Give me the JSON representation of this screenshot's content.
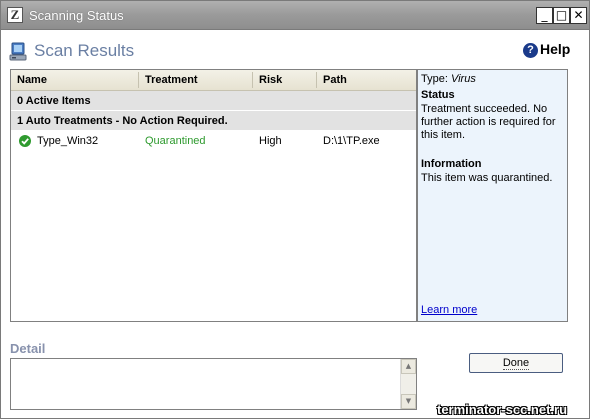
{
  "window": {
    "title": "Scanning Status",
    "logo_glyph": "Z",
    "minimize_glyph": "_",
    "maximize_glyph": "□",
    "close_glyph": "✕"
  },
  "header": {
    "title": "Scan Results",
    "help_label": "Help",
    "help_glyph": "?"
  },
  "results": {
    "columns": [
      "Name",
      "Treatment",
      "Risk",
      "Path"
    ],
    "groups": [
      {
        "label": "0 Active Items"
      },
      {
        "label": "1 Auto Treatments - No Action Required."
      }
    ],
    "items": [
      {
        "name": "Type_Win32",
        "treatment": "Quarantined",
        "risk": "High",
        "path": "D:\\1\\TP.exe",
        "status_icon": "check-circle-icon"
      }
    ]
  },
  "info": {
    "type_label": "Type:",
    "type_value": "Virus",
    "status_heading": "Status",
    "status_text": "Treatment succeeded. No further action is required for this item.",
    "information_heading": "Information",
    "information_text": "This item was quarantined.",
    "learn_more": "Learn more"
  },
  "detail": {
    "label": "Detail"
  },
  "done_label": "Done",
  "watermark": "terminator-scc.net.ru",
  "colors": {
    "title_accent": "#6a7fa3",
    "info_background": "#ecf4fc",
    "quarantined_text": "#2e9a2e",
    "link": "#0000cc"
  }
}
